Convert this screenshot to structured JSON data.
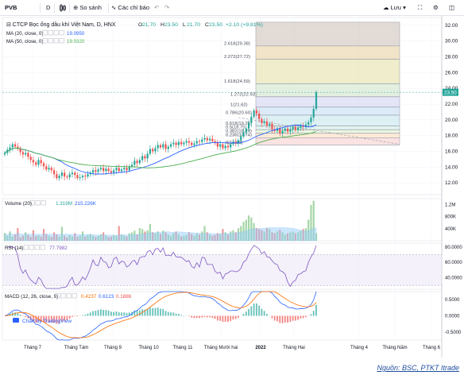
{
  "toolbar": {
    "symbol": "PVB",
    "interval": "D",
    "compare_label": "So sánh",
    "indicators_label": "Các chỉ báo",
    "save_label": "Lưu"
  },
  "legend": {
    "title": "CTCP Bọc ống dầu khí Việt Nam, D, HNX",
    "ohlc": [
      {
        "k": "O",
        "v": "21.70"
      },
      {
        "k": "H",
        "v": "23.50"
      },
      {
        "k": "L",
        "v": "21.70"
      },
      {
        "k": "C",
        "v": "23.50"
      }
    ],
    "change": "+2.10 (+9.81%)",
    "ma20_label": "MA (20, close, 0)",
    "ma20_value": "19.0950",
    "ma50_label": "MA (50, close, 0)",
    "ma50_value": "19.0320"
  },
  "colors": {
    "up": "#26a69a",
    "down": "#ef5350",
    "ma20": "#2962ff",
    "ma50": "#4caf50",
    "rsi": "#7e57c2",
    "macd": "#2962ff",
    "signal": "#ff6d00",
    "price_badge": "#26a69a"
  },
  "chart_data": [
    {
      "type": "candlestick",
      "title": "CTCP Bọc ống dầu khí Việt Nam, D, HNX",
      "x_ticks": [
        "Tháng 7",
        "Tháng Tám",
        "Tháng 9",
        "Tháng 10",
        "Tháng 11",
        "Tháng Mười hai",
        "2022",
        "Tháng Hai",
        "Tháng 4",
        "Tháng Năm",
        "Tháng 6"
      ],
      "ylim": [
        10.5,
        33
      ],
      "y_ticks": [
        12.0,
        14.0,
        16.0,
        18.0,
        20.0,
        22.0,
        24.0,
        26.0,
        28.0,
        30.0,
        32.0
      ],
      "last_price": "23.50",
      "series": [
        {
          "name": "Close (approx.)",
          "values": [
            15.8,
            16.2,
            16.5,
            16.9,
            16.6,
            16.4,
            15.9,
            15.6,
            15.8,
            15.3,
            14.9,
            14.6,
            14.3,
            14.9,
            14.5,
            14.1,
            13.7,
            13.9,
            13.6,
            13.1,
            12.6,
            12.9,
            13.3,
            12.8,
            12.7,
            13.1,
            13.3,
            13.0,
            12.6,
            12.7,
            12.9,
            12.8,
            13.1,
            13.3,
            13.6,
            13.4,
            13.7,
            13.9,
            13.5,
            13.8,
            13.5,
            13.3,
            13.6,
            13.9,
            13.5,
            13.7,
            13.9,
            13.6,
            14.1,
            14.3,
            14.8,
            14.5,
            14.9,
            15.4,
            15.1,
            15.7,
            16.3,
            16.0,
            16.4,
            16.8,
            16.5,
            16.9,
            16.3,
            16.6,
            16.9,
            17.1,
            16.8,
            17.2,
            16.9,
            17.1,
            17.3,
            17.1,
            16.8,
            17.0,
            17.3,
            17.2,
            17.5,
            17.7,
            17.4,
            17.6,
            17.3,
            17.1,
            16.6,
            16.9,
            16.4,
            16.7,
            16.5,
            16.9,
            17.2,
            17.0,
            17.4,
            17.9,
            18.4,
            18.9,
            19.6,
            20.4,
            21.2,
            20.8,
            20.1,
            19.6,
            19.8,
            19.3,
            19.5,
            18.8,
            18.6,
            18.9,
            18.3,
            18.6,
            18.9,
            18.5,
            18.8,
            19.1,
            18.7,
            19.0,
            19.3,
            19.1,
            19.4,
            19.7,
            20.3,
            21.4,
            23.5
          ]
        },
        {
          "name": "MA (20, close, 0)",
          "last": 19.095
        },
        {
          "name": "MA (50, close, 0)",
          "last": 19.032
        }
      ],
      "fibonacci": [
        {
          "ratio": "0(16.83)",
          "price": 16.83
        },
        {
          "ratio": "0.236(17.74)",
          "price": 17.74
        },
        {
          "ratio": "0.382(18.29)",
          "price": 18.29
        },
        {
          "ratio": "0.5(18.75)",
          "price": 18.75
        },
        {
          "ratio": "0.618(19.25)",
          "price": 19.25
        },
        {
          "ratio": "0.786(20.60)",
          "price": 20.6
        },
        {
          "ratio": "1(21.62)",
          "price": 21.62
        },
        {
          "ratio": "1.272(22.93)",
          "price": 22.93
        },
        {
          "ratio": "1.618(24.59)",
          "price": 24.59
        },
        {
          "ratio": "2.272(27.72)",
          "price": 27.72
        },
        {
          "ratio": "2.618(29.38)",
          "price": 29.38
        }
      ]
    },
    {
      "type": "bar",
      "title": "Volume (20)",
      "values_shown": [
        "1.319M",
        "215.226K"
      ],
      "y_ticks": [
        "1.2M",
        "800K",
        "400K"
      ],
      "ylim": [
        0,
        1400000
      ]
    },
    {
      "type": "line",
      "title": "RSI (14)",
      "value_shown": "77.7982",
      "y_ticks": [
        "80.0000",
        "60.0000",
        "40.0000"
      ],
      "bands": [
        30,
        70
      ],
      "ylim": [
        25,
        85
      ]
    },
    {
      "type": "line",
      "title": "MACD (12, 26, close, 9)",
      "values_shown": [
        "0.4237",
        "0.6123",
        "0.1886"
      ],
      "y_ticks": [
        "0.5000",
        "0.0000",
        "-0.5000"
      ],
      "ylim": [
        -0.75,
        0.75
      ]
    }
  ],
  "branding": {
    "tradingview": "Chart by TradingView"
  },
  "source": "Nguồn: BSC, PTKT Itrade"
}
